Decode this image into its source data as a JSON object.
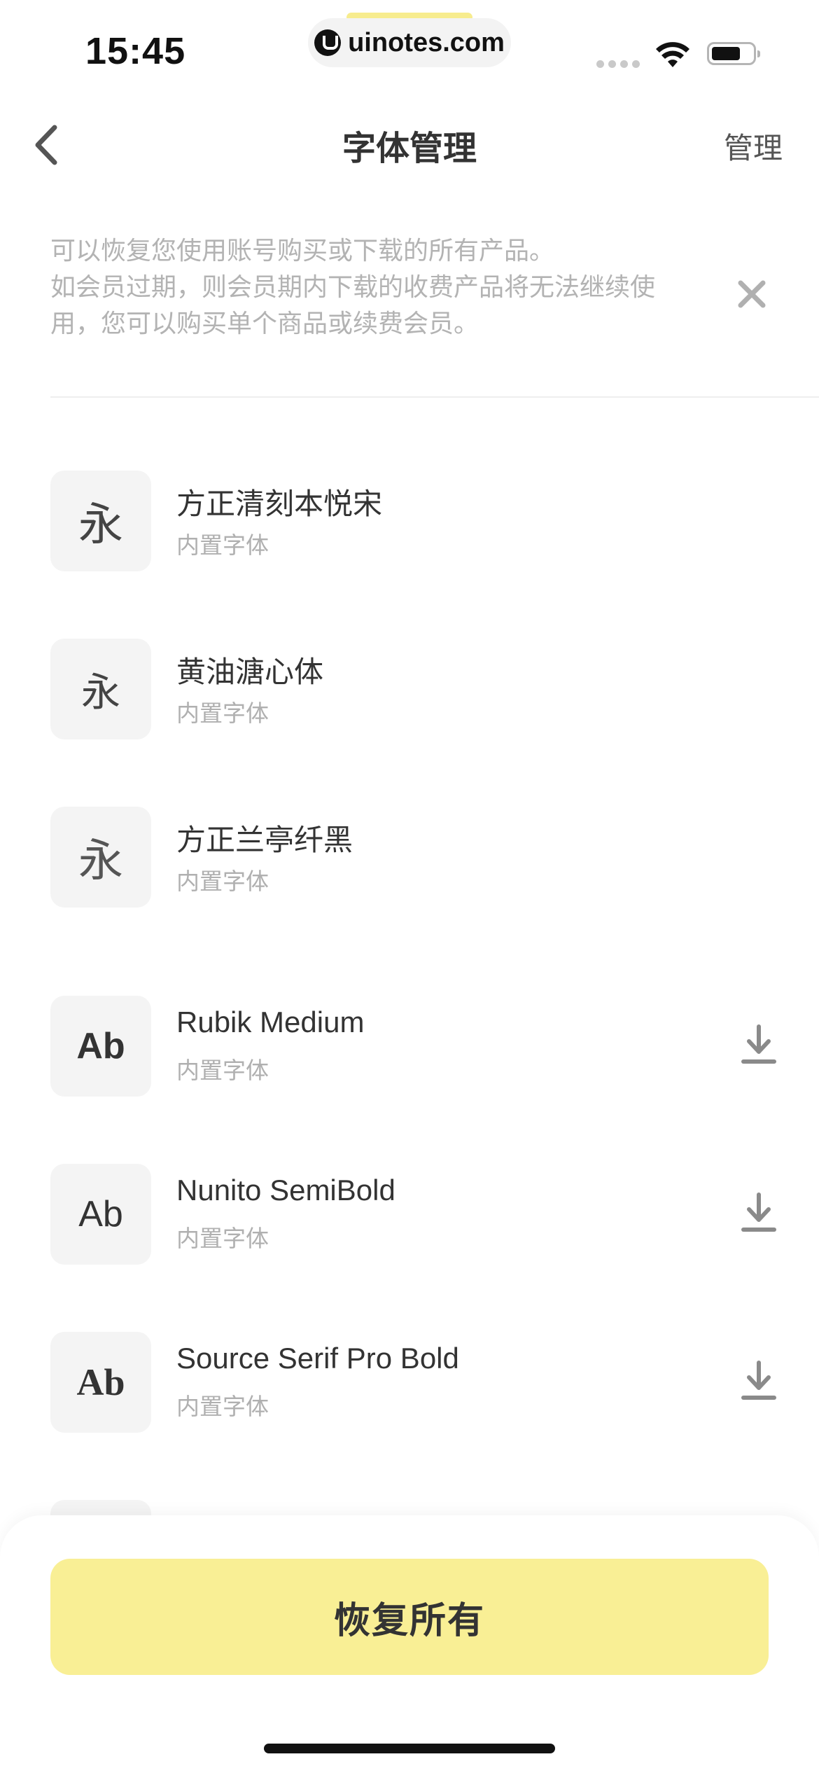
{
  "status_bar": {
    "time": "15:45",
    "watermark": "uinotes.com"
  },
  "nav": {
    "title": "字体管理",
    "manage_label": "管理"
  },
  "notice": {
    "lines": [
      "可以恢复您使用账号购买或下载的所有产品。",
      "如会员过期，则会员期内下载的收费产品将无法继续使",
      "用，您可以购买单个商品或续费会员。"
    ]
  },
  "fonts": [
    {
      "name": "方正清刻本悦宋",
      "sub": "内置字体",
      "thumb": "永",
      "download": false
    },
    {
      "name": "黄油溏心体",
      "sub": "内置字体",
      "thumb": "永",
      "download": false
    },
    {
      "name": "方正兰亭纤黑",
      "sub": "内置字体",
      "thumb": "永",
      "download": false
    },
    {
      "name": "Rubik Medium",
      "sub": "内置字体",
      "thumb": "Ab",
      "download": true
    },
    {
      "name": "Nunito SemiBold",
      "sub": "内置字体",
      "thumb": "Ab",
      "download": true
    },
    {
      "name": "Source Serif Pro Bold",
      "sub": "内置字体",
      "thumb": "Ab",
      "download": true
    }
  ],
  "bottom": {
    "restore_label": "恢复所有"
  },
  "colors": {
    "accent_yellow": "#f9ef95",
    "thumb_bg": "#f4f4f4",
    "muted_text": "#b3b3b3"
  }
}
